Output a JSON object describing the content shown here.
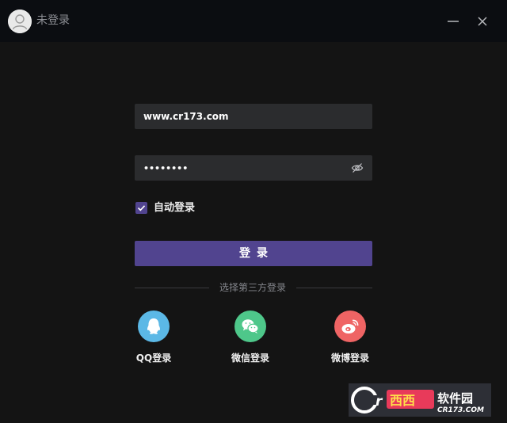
{
  "titlebar": {
    "title": "未登录",
    "avatar_icon": "user-avatar-icon",
    "minimize_icon": "minimize-icon",
    "close_icon": "close-icon"
  },
  "login_form": {
    "username_value": "www.cr173.com",
    "password_value": "••••••••",
    "password_toggle_icon": "eye-off-icon",
    "auto_login_label": "自动登录",
    "auto_login_checked": true,
    "login_button_label": "登录"
  },
  "third_party": {
    "divider_text": "选择第三方登录",
    "options": [
      {
        "label": "QQ登录",
        "icon": "qq-icon",
        "color": "#5bb8e6"
      },
      {
        "label": "微信登录",
        "icon": "wechat-icon",
        "color": "#4ec78a"
      },
      {
        "label": "微博登录",
        "icon": "weibo-icon",
        "color": "#ef6464"
      }
    ]
  },
  "watermark": {
    "logo_text": "西西软件园",
    "site": "CR173.COM"
  },
  "colors": {
    "accent": "#51448f",
    "background": "#141414",
    "titlebar": "#0b0d11",
    "field": "#2b2c2e"
  }
}
